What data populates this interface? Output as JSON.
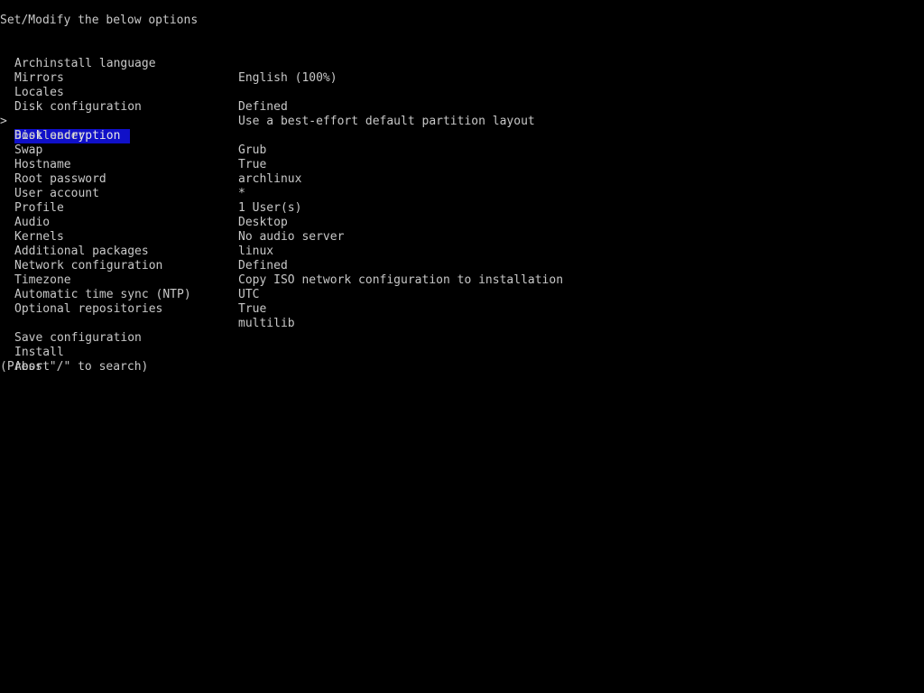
{
  "header": {
    "title": "Set/Modify the below options"
  },
  "menu": {
    "cursor": ">",
    "selected_index": 4,
    "items": [
      {
        "label": "Archinstall language",
        "value": "English (100%)"
      },
      {
        "label": "Mirrors",
        "value": ""
      },
      {
        "label": "Locales",
        "value": "Defined"
      },
      {
        "label": "Disk configuration",
        "value": "Use a best-effort default partition layout"
      },
      {
        "label": "Disk encryption",
        "value": ""
      },
      {
        "label": "Bootloader",
        "value": "Grub"
      },
      {
        "label": "Swap",
        "value": "True"
      },
      {
        "label": "Hostname",
        "value": "archlinux"
      },
      {
        "label": "Root password",
        "value": "*"
      },
      {
        "label": "User account",
        "value": "1 User(s)"
      },
      {
        "label": "Profile",
        "value": "Desktop"
      },
      {
        "label": "Audio",
        "value": "No audio server"
      },
      {
        "label": "Kernels",
        "value": "linux"
      },
      {
        "label": "Additional packages",
        "value": "Defined"
      },
      {
        "label": "Network configuration",
        "value": "Copy ISO network configuration to installation"
      },
      {
        "label": "Timezone",
        "value": "UTC"
      },
      {
        "label": "Automatic time sync (NTP)",
        "value": "True"
      },
      {
        "label": "Optional repositories",
        "value": "multilib"
      }
    ]
  },
  "actions": [
    {
      "label": "Save configuration"
    },
    {
      "label": "Install"
    },
    {
      "label": "Abort"
    }
  ],
  "footer": {
    "hint": "(Press \"/\" to search)"
  },
  "colors": {
    "background": "#000000",
    "text": "#c8c8c8",
    "selection_bg": "#1010c8"
  }
}
